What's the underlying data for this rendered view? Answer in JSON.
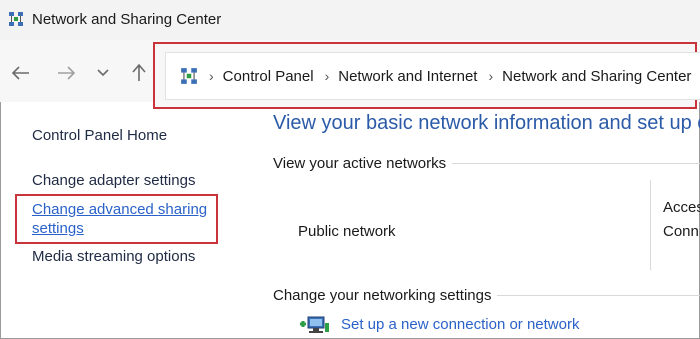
{
  "window": {
    "title": "Network and Sharing Center"
  },
  "nav": {
    "breadcrumbs": [
      "Control Panel",
      "Network and Internet",
      "Network and Sharing Center"
    ]
  },
  "sidebar": {
    "items": [
      {
        "label": "Control Panel Home"
      },
      {
        "label": "Change adapter settings"
      },
      {
        "label": "Change advanced sharing",
        "label2": "settings"
      },
      {
        "label": "Media streaming options"
      }
    ]
  },
  "main": {
    "title": "View your basic network information and set up c",
    "active_networks_header": "View your active networks",
    "network_name": "Public network",
    "access_label_1": "Acces",
    "access_label_2": "Conn",
    "change_settings_header": "Change your networking settings",
    "setup_link": "Set up a new connection or network"
  },
  "colors": {
    "highlight": "#c9343a",
    "link": "#2a62c9",
    "title": "#2b5aa8"
  },
  "icons": [
    "network-center-icon",
    "back-arrow-icon",
    "forward-arrow-icon",
    "chevron-down-icon",
    "up-arrow-icon",
    "setup-connection-icon"
  ]
}
